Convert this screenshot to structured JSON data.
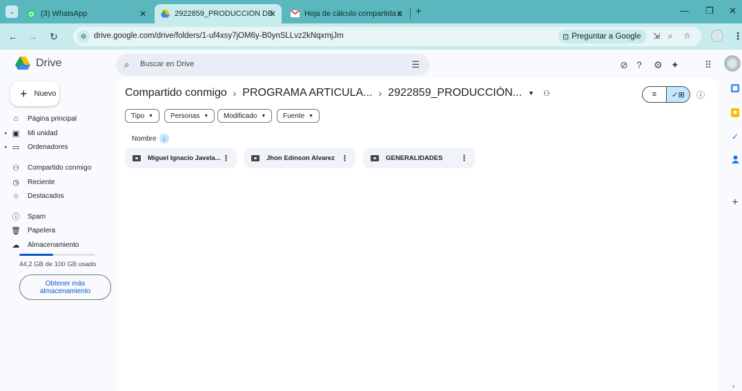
{
  "browser": {
    "tabs": [
      {
        "title": "(3) WhatsApp",
        "icon": "whatsapp-icon"
      },
      {
        "title": "2922859_PRODUCCIÓN DE CAF",
        "icon": "google-drive-icon",
        "active": true
      },
      {
        "title": "Hoja de cálculo compartida co",
        "icon": "gmail-icon"
      }
    ],
    "new_tab": "+",
    "url": "drive.google.com/drive/folders/1-uf4xsy7jOM6y-B0ynSLLvz2kNqxmjJm",
    "ask_google": "Preguntar a Google"
  },
  "drive": {
    "logo_text": "Drive",
    "search_placeholder": "Buscar en Drive",
    "new_label": "Nuevo",
    "nav": [
      {
        "label": "Página principal",
        "icon": "home-icon"
      },
      {
        "label": "Mi unidad",
        "icon": "my-drive-icon"
      },
      {
        "label": "Ordenadores",
        "icon": "computer-icon"
      },
      {
        "label": "Compartido conmigo",
        "icon": "shared-icon"
      },
      {
        "label": "Reciente",
        "icon": "clock-icon"
      },
      {
        "label": "Destacados",
        "icon": "star-icon"
      },
      {
        "label": "Spam",
        "icon": "spam-icon"
      },
      {
        "label": "Papelera",
        "icon": "trash-icon"
      },
      {
        "label": "Almacenamiento",
        "icon": "cloud-icon"
      }
    ],
    "storage": {
      "text": "44,2 GB de 100 GB usado",
      "fraction": 0.442
    },
    "more_storage": "Obtener más\nalmacenamiento",
    "breadcrumb": [
      "Compartido conmigo",
      "PROGRAMA ARTICULA...",
      "2922859_PRODUCCIÓN..."
    ],
    "filters": [
      "Tipo",
      "Personas",
      "Modificado",
      "Fuente"
    ],
    "sort_label": "Nombre",
    "folders": [
      "Miguel Ignacio Javela...",
      "Jhon Edinson Alvarez",
      "GENERALIDADES"
    ]
  },
  "colors": {
    "tab_strip": "#59b7bd",
    "toolbar": "#c8ecee",
    "accent": "#0b57d0",
    "selected": "#c2e7ff"
  }
}
